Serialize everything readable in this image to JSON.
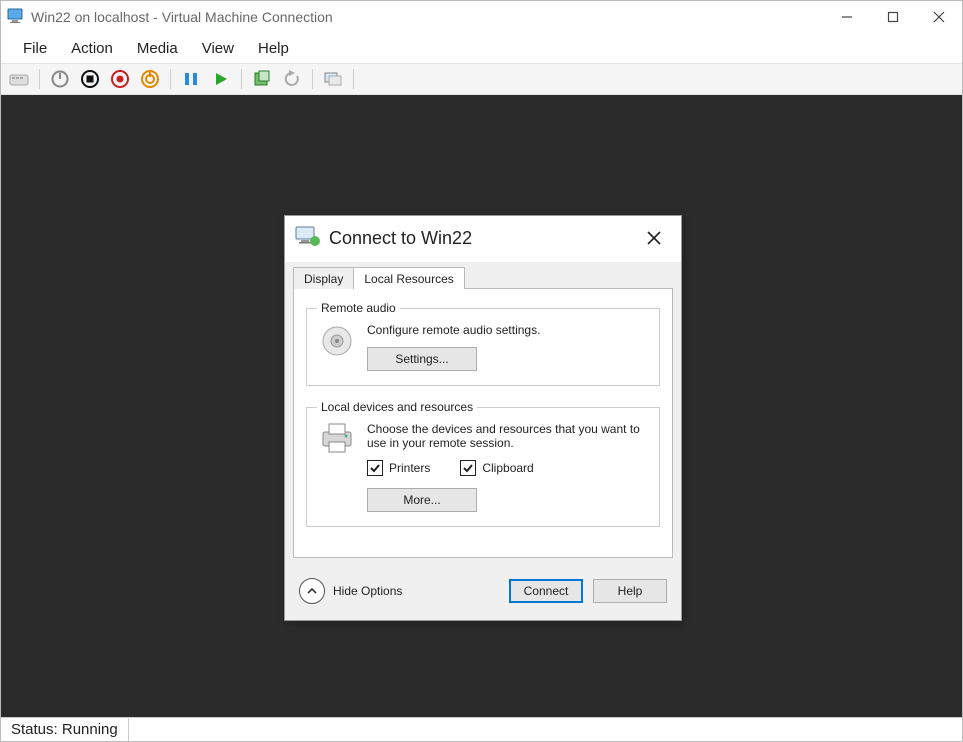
{
  "window": {
    "title": "Win22 on localhost - Virtual Machine Connection"
  },
  "menu": {
    "file": "File",
    "action": "Action",
    "media": "Media",
    "view": "View",
    "help": "Help"
  },
  "status": {
    "text": "Status: Running"
  },
  "dialog": {
    "title": "Connect to Win22",
    "tabs": {
      "display": "Display",
      "local": "Local Resources"
    },
    "audio": {
      "legend": "Remote audio",
      "desc": "Configure remote audio settings.",
      "settings_btn": "Settings..."
    },
    "local": {
      "legend": "Local devices and resources",
      "desc": "Choose the devices and resources that you want to use in your remote session.",
      "printers": "Printers",
      "clipboard": "Clipboard",
      "more_btn": "More..."
    },
    "footer": {
      "hide": "Hide Options",
      "connect": "Connect",
      "help": "Help"
    }
  }
}
